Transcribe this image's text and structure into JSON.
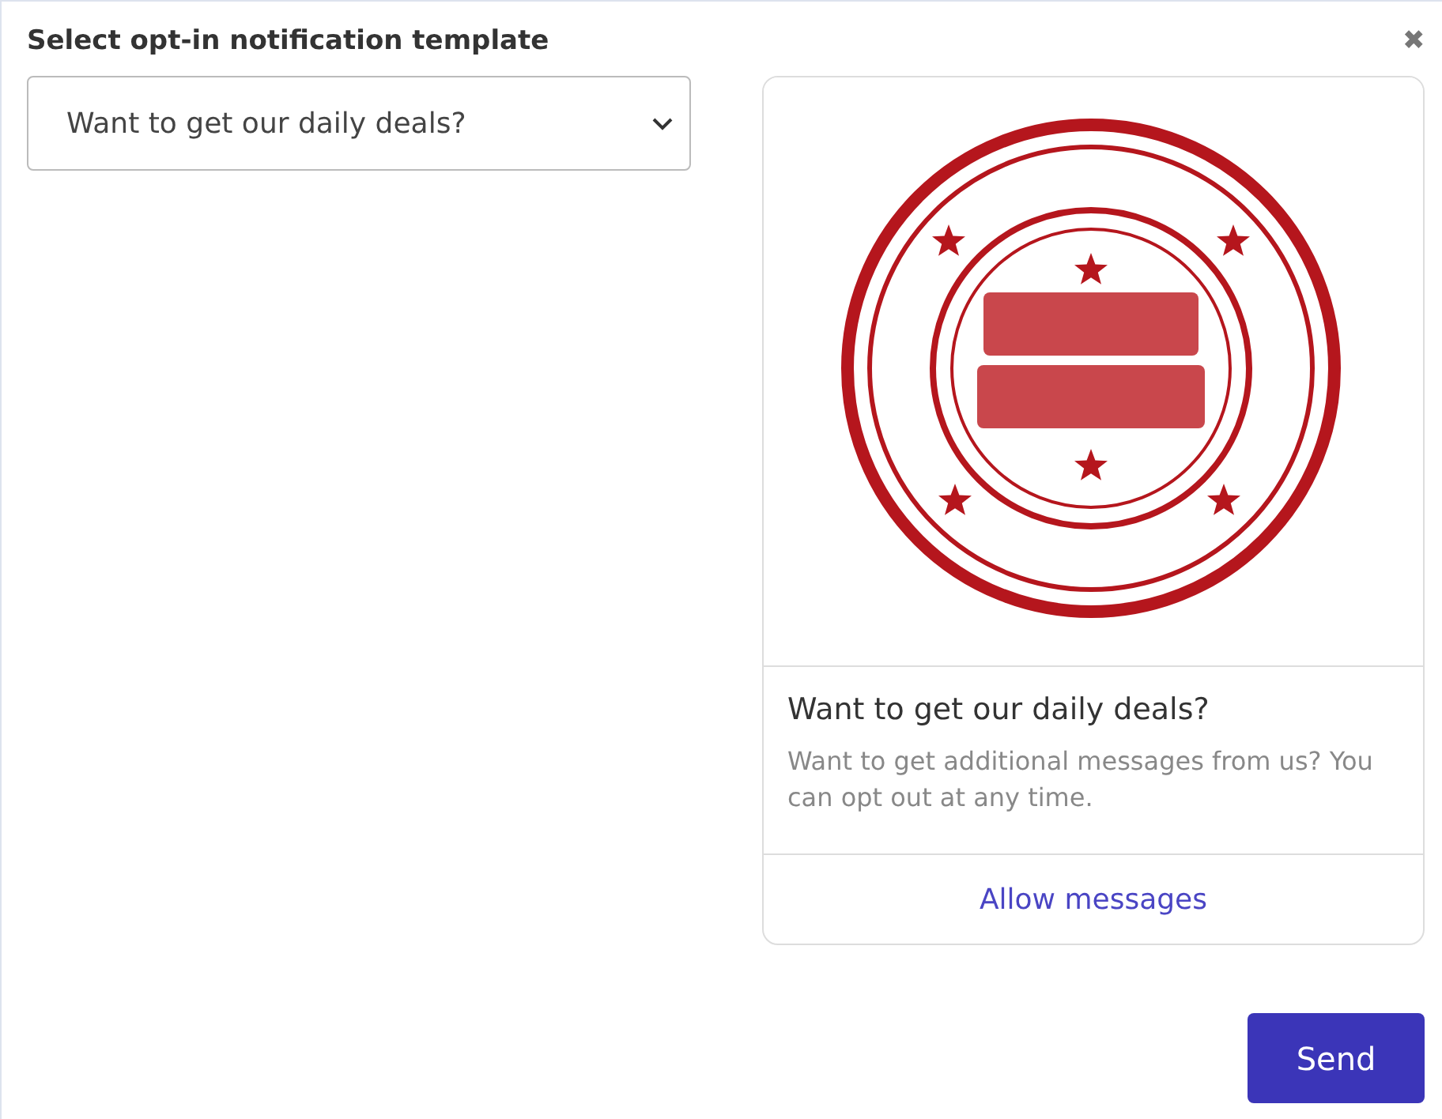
{
  "dialog": {
    "title": "Select opt-in notification template",
    "close_icon": "✖"
  },
  "template_select": {
    "value": "Want to get our daily deals?"
  },
  "preview": {
    "title": "Want to get our daily deals?",
    "description": "Want to get additional messages from us? You can opt out at any time.",
    "action": "Allow messages"
  },
  "buttons": [
    {
      "label": "Send",
      "kind": "primary"
    }
  ]
}
